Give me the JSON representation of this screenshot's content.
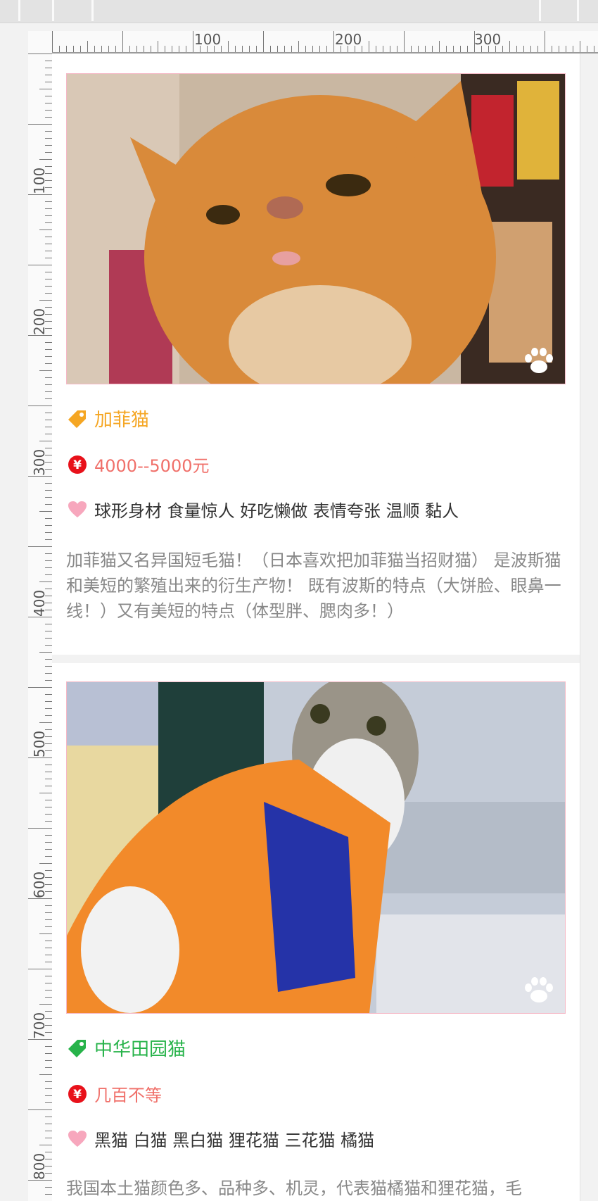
{
  "ruler": {
    "h_labels": [
      "100",
      "200",
      "300"
    ],
    "v_labels": [
      "100",
      "200",
      "300",
      "400",
      "500",
      "600",
      "700",
      "800"
    ]
  },
  "cards": [
    {
      "name": "加菲猫",
      "name_color": "#f5a623",
      "price": "4000--5000元",
      "tags": "球形身材 食量惊人 好吃懒做 表情夸张 温顺 黏人",
      "desc": "加菲猫又名异国短毛猫！（日本喜欢把加菲猫当招财猫） 是波斯猫和美短的繁殖出来的衍生产物！ 既有波斯的特点（大饼脸、眼鼻一线！）又有美短的特点（体型胖、腮肉多！）"
    },
    {
      "name": "中华田园猫",
      "name_color": "#27b34a",
      "price": "几百不等",
      "tags": "黑猫 白猫 黑白猫 狸花猫 三花猫 橘猫",
      "desc": "我国本土猫颜色多、品种多、机灵，代表猫橘猫和狸花猫，毛"
    }
  ],
  "colors": {
    "price_icon": "#e8111a",
    "heart_icon": "#f7a7bd",
    "photo_border": "#f5b8c6"
  },
  "icons": [
    "tag-icon",
    "yuan-icon",
    "heart-icon",
    "paw-icon"
  ]
}
